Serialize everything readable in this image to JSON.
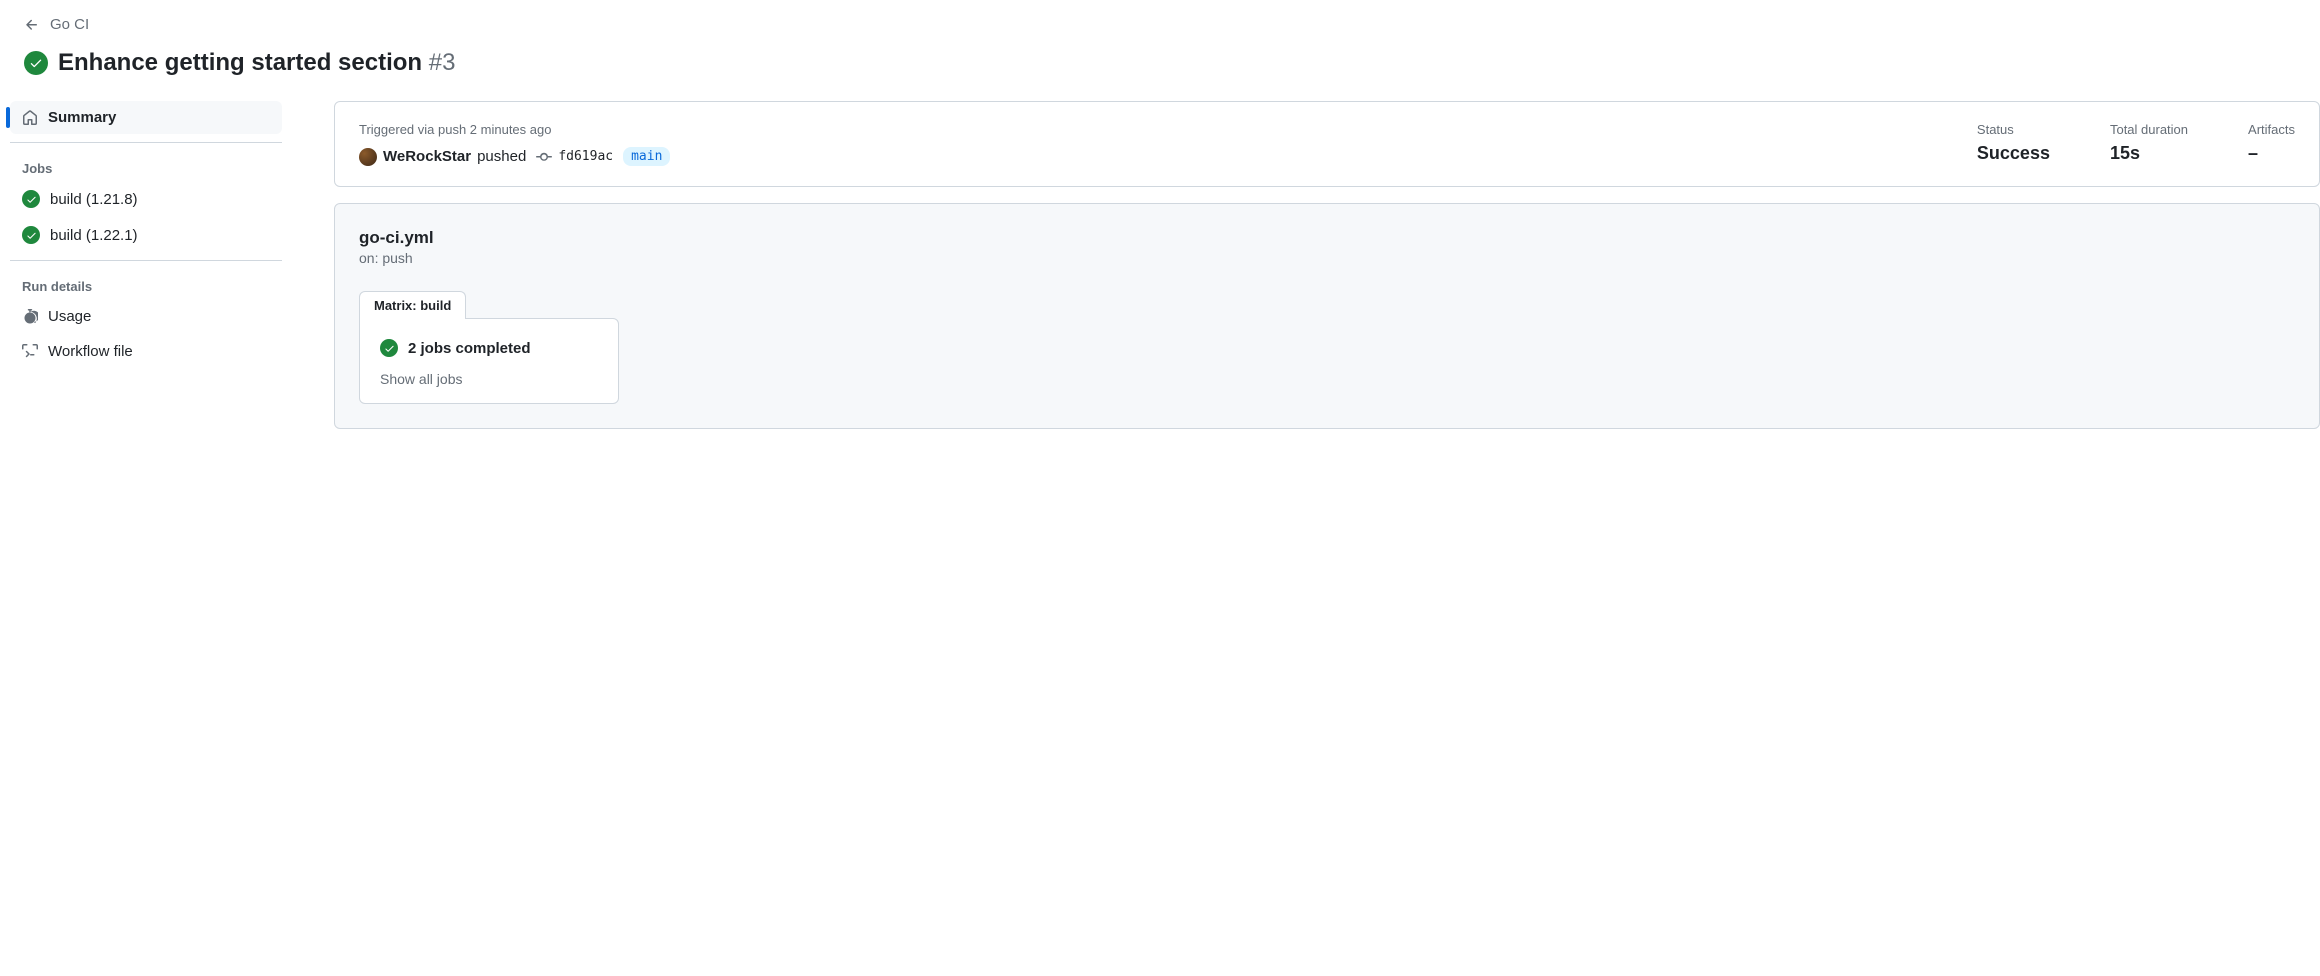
{
  "breadcrumb": {
    "workflow_name": "Go CI"
  },
  "header": {
    "title": "Enhance getting started section",
    "run_number": "#3"
  },
  "sidebar": {
    "summary_label": "Summary",
    "jobs_heading": "Jobs",
    "jobs": [
      {
        "label": "build (1.21.8)"
      },
      {
        "label": "build (1.22.1)"
      }
    ],
    "run_details_heading": "Run details",
    "usage_label": "Usage",
    "workflow_file_label": "Workflow file"
  },
  "summary": {
    "trigger_label": "Triggered via push 2 minutes ago",
    "actor": "WeRockStar",
    "pushed_text": "pushed",
    "commit_sha": "fd619ac",
    "branch": "main",
    "status_label": "Status",
    "status_value": "Success",
    "duration_label": "Total duration",
    "duration_value": "15s",
    "artifacts_label": "Artifacts",
    "artifacts_value": "–"
  },
  "workflow": {
    "file": "go-ci.yml",
    "event": "on: push",
    "matrix_label": "Matrix: build",
    "completed_text": "2 jobs completed",
    "show_all_label": "Show all jobs"
  }
}
